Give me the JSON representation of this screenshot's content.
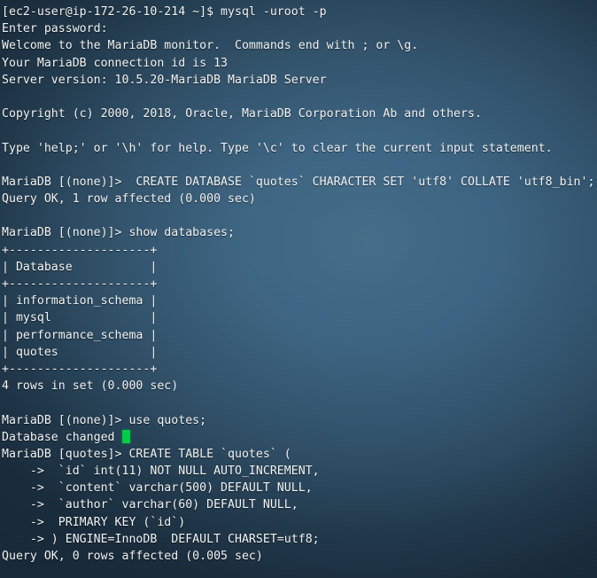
{
  "terminal": {
    "colors": {
      "background_light": "#3f6a86",
      "background_dark": "#1a2c3c",
      "foreground": "#f2f3f3",
      "cursor": "#00cc44"
    },
    "prompt_host": "[ec2-user@ip-172-26-10-214 ~]$",
    "mysql_prompt_none": "MariaDB [(none)]>",
    "mysql_prompt_quotes": "MariaDB [quotes]>",
    "continuation_prompt": "->",
    "lines": [
      "[ec2-user@ip-172-26-10-214 ~]$ mysql -uroot -p",
      "Enter password:",
      "Welcome to the MariaDB monitor.  Commands end with ; or \\g.",
      "Your MariaDB connection id is 13",
      "Server version: 10.5.20-MariaDB MariaDB Server",
      "",
      "Copyright (c) 2000, 2018, Oracle, MariaDB Corporation Ab and others.",
      "",
      "Type 'help;' or '\\h' for help. Type '\\c' to clear the current input statement.",
      "",
      "MariaDB [(none)]>  CREATE DATABASE `quotes` CHARACTER SET 'utf8' COLLATE 'utf8_bin';",
      "Query OK, 1 row affected (0.000 sec)",
      "",
      "MariaDB [(none)]> show databases;",
      "+--------------------+",
      "| Database           |",
      "+--------------------+",
      "| information_schema |",
      "| mysql              |",
      "| performance_schema |",
      "| quotes             |",
      "+--------------------+",
      "4 rows in set (0.000 sec)",
      "",
      "MariaDB [(none)]> use quotes;",
      "Database changed",
      "MariaDB [quotes]> CREATE TABLE `quotes` (",
      "    ->  `id` int(11) NOT NULL AUTO_INCREMENT,",
      "    ->  `content` varchar(500) DEFAULT NULL,",
      "    ->  `author` varchar(60) DEFAULT NULL,",
      "    ->  PRIMARY KEY (`id`)",
      "    -> ) ENGINE=InnoDB  DEFAULT CHARSET=utf8;",
      "Query OK, 0 rows affected (0.005 sec)",
      ""
    ],
    "cursor": {
      "line_index": 24,
      "column": 18,
      "glyph": "block-cursor"
    },
    "session": {
      "welcome": "Welcome to the MariaDB monitor.",
      "connection_id": "13",
      "server_version": "10.5.20-MariaDB MariaDB Server",
      "copyright": "Copyright (c) 2000, 2018, Oracle, MariaDB Corporation Ab and others.",
      "database_created": "quotes",
      "charset": "utf8",
      "collation": "utf8_bin",
      "engine": "InnoDB",
      "databases": [
        "information_schema",
        "mysql",
        "performance_schema",
        "quotes"
      ],
      "databases_header": "Database",
      "databases_row_count": "4 rows in set (0.000 sec)",
      "create_db_result": "Query OK, 1 row affected (0.000 sec)",
      "use_result": "Database changed",
      "create_table_result": "Query OK, 0 rows affected (0.005 sec)",
      "table_columns": [
        {
          "name": "id",
          "type": "int(11)",
          "attrs": "NOT NULL AUTO_INCREMENT"
        },
        {
          "name": "content",
          "type": "varchar(500)",
          "attrs": "DEFAULT NULL"
        },
        {
          "name": "author",
          "type": "varchar(60)",
          "attrs": "DEFAULT NULL"
        },
        {
          "name": "PRIMARY KEY",
          "type": "(`id`)",
          "attrs": ""
        }
      ]
    }
  }
}
